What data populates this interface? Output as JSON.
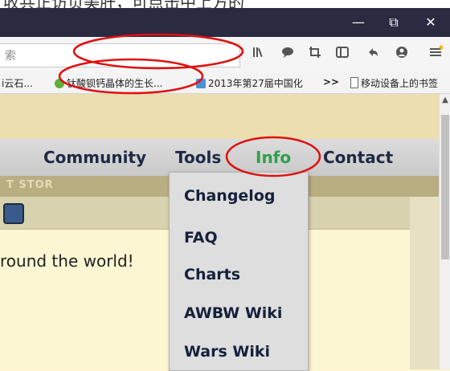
{
  "caption": {
    "text": "收共正访页美肝，可点击中上方的"
  },
  "window": {
    "minimize_glyph": "—",
    "restore_glyph": "⧉",
    "close_glyph": "✕"
  },
  "address_bar": {
    "partial_text": "索"
  },
  "toolbar_icons": [
    "library-icon",
    "chat-icon",
    "screenshot-icon",
    "reader-icon",
    "back-icon",
    "account-icon",
    "menu-icon"
  ],
  "bookmarks": {
    "items": [
      {
        "label": "i云石...",
        "icon": "none"
      },
      {
        "label": "钛酸钡钙晶体的生长...",
        "icon": "green-circle-icon"
      },
      {
        "label": "2013年第27届中国化",
        "icon": "paw-icon"
      },
      {
        "label": ">>",
        "icon": "overflow"
      },
      {
        "label": "移动设备上的书签",
        "icon": "mobile-bookmark-icon"
      }
    ]
  },
  "nav": {
    "items": [
      {
        "label": "Community"
      },
      {
        "label": "Tools"
      },
      {
        "label": "Info"
      },
      {
        "label": "Contact"
      }
    ],
    "active": "Info",
    "active_color": "#2fa04c"
  },
  "subband_text": "T STOR",
  "dropdown": {
    "items": [
      {
        "label": "Changelog"
      },
      {
        "label": "FAQ"
      },
      {
        "label": "Charts"
      },
      {
        "label": "AWBW Wiki"
      },
      {
        "label": "Wars Wiki"
      }
    ]
  },
  "content": {
    "welcome_text": "round the world!"
  },
  "annotation_color": "#e01010"
}
